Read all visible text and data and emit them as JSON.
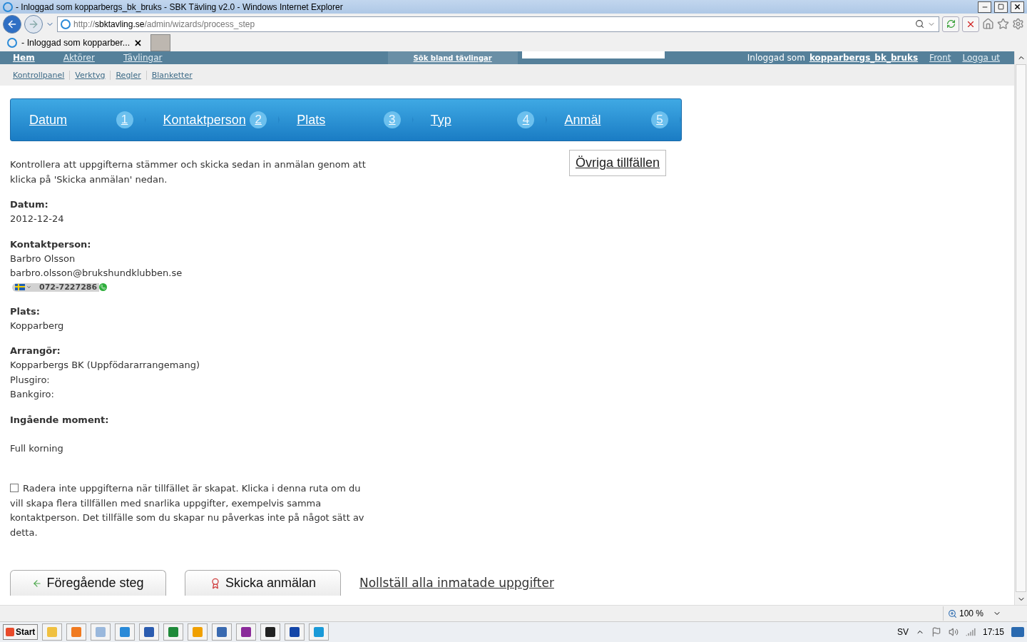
{
  "window": {
    "title": "- Inloggad som kopparbergs_bk_bruks - SBK Tävling v2.0 - Windows Internet Explorer"
  },
  "address": {
    "scheme": "http://",
    "host": "sbktavling.se",
    "path": "/admin/wizards/process_step"
  },
  "tab": {
    "label": "- Inloggad som kopparber...",
    "close": "✕"
  },
  "site_nav": {
    "items": [
      {
        "label": "Hem",
        "selected": true
      },
      {
        "label": "Aktörer",
        "selected": false
      },
      {
        "label": "Tävlingar",
        "selected": false
      }
    ],
    "search_link": "Sök bland tävlingar",
    "login_prefix": "Inloggad som",
    "user": "kopparbergs_bk_bruks",
    "links": [
      "Front",
      "Logga ut"
    ]
  },
  "sub_nav": [
    "Kontrollpanel",
    "Verktyg",
    "Regler",
    "Blanketter"
  ],
  "wizard_steps": [
    {
      "label": "Datum",
      "number": "1"
    },
    {
      "label": "Kontaktperson",
      "number": "2"
    },
    {
      "label": "Plats",
      "number": "3"
    },
    {
      "label": "Typ",
      "number": "4"
    },
    {
      "label": "Anmäl",
      "number": "5"
    }
  ],
  "intro": "Kontrollera att uppgifterna stämmer och skicka sedan in anmälan genom att klicka på 'Skicka anmälan' nedan.",
  "other_button": "Övriga tillfällen",
  "sections": [
    {
      "heading": "Datum:",
      "lines": [
        {
          "kind": "text",
          "text": "2012-12-24"
        }
      ]
    },
    {
      "heading": "Kontaktperson:",
      "lines": [
        {
          "kind": "text",
          "text": "Barbro Olsson"
        },
        {
          "kind": "text",
          "text": "barbro.olsson@brukshundklubben.se"
        },
        {
          "kind": "phone",
          "text": "072-7227286"
        }
      ]
    },
    {
      "heading": "Plats:",
      "lines": [
        {
          "kind": "text",
          "text": "Kopparberg"
        }
      ]
    },
    {
      "heading": "Arrangör:",
      "lines": [
        {
          "kind": "text",
          "text": "Kopparbergs BK (Uppfödararrangemang)"
        },
        {
          "kind": "text",
          "text": "Plusgiro:"
        },
        {
          "kind": "text",
          "text": "Bankgiro:"
        }
      ]
    },
    {
      "heading": "Ingående moment:",
      "lines": [
        {
          "kind": "gap"
        },
        {
          "kind": "text",
          "text": "Full korning"
        }
      ]
    }
  ],
  "keep_data": {
    "checked": false,
    "text": "Radera inte uppgifterna när tillfället är skapat. Klicka i denna ruta om du vill skapa flera tillfällen med snarlika uppgifter, exempelvis samma kontaktperson. Det tillfälle som du skapar nu påverkas inte på något sätt av detta."
  },
  "buttons": [
    {
      "kind": "back",
      "label": "Föregående steg"
    },
    {
      "kind": "submit",
      "label": "Skicka anmälan"
    }
  ],
  "reset_link": "Nollställ alla inmatade uppgifter",
  "status_bar": {
    "zoom": "100 %"
  },
  "taskbar": {
    "start": "Start",
    "language": "SV",
    "clock": "17:15"
  }
}
